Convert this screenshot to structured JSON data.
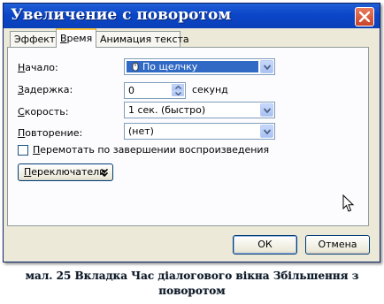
{
  "dialog": {
    "title": "Увеличение с поворотом",
    "tabs": [
      {
        "label": "Эффект"
      },
      {
        "label_u": "В",
        "label_rest": "ремя"
      },
      {
        "label": "Анимация текста"
      }
    ],
    "fields": {
      "start": {
        "label_u": "Н",
        "label_rest": "ачало:",
        "value": "По щелчку"
      },
      "delay": {
        "label_u": "З",
        "label_rest": "адержка:",
        "value": "0",
        "unit": "секунд"
      },
      "speed": {
        "label_u": "С",
        "label_rest": "корость:",
        "value": "1 сек. (быстро)"
      },
      "repeat": {
        "label_u": "П",
        "label_rest": "овторение:",
        "value": "(нет)"
      }
    },
    "rewind": {
      "label_u": "П",
      "label_rest": "еремотать по завершении воспроизведения",
      "checked": false
    },
    "triggers_button": {
      "label_u": "П",
      "label_rest": "ереключатели"
    },
    "ok_label": "ОК",
    "cancel_label": "Отмена"
  },
  "caption": "мал. 25 Вкладка Час діалогового вікна Збільшення з поворотом",
  "icons": [
    "close-icon",
    "mouse-click-icon",
    "dropdown-arrow-icon",
    "spin-up-icon",
    "spin-down-icon",
    "chevron-double-down-icon",
    "mouse-cursor-icon"
  ],
  "colors": {
    "titlebar": "#0b46c8",
    "dialog_bg": "#ece9d8",
    "selection": "#316ac5",
    "active_tab_accent": "#ffc83c"
  }
}
